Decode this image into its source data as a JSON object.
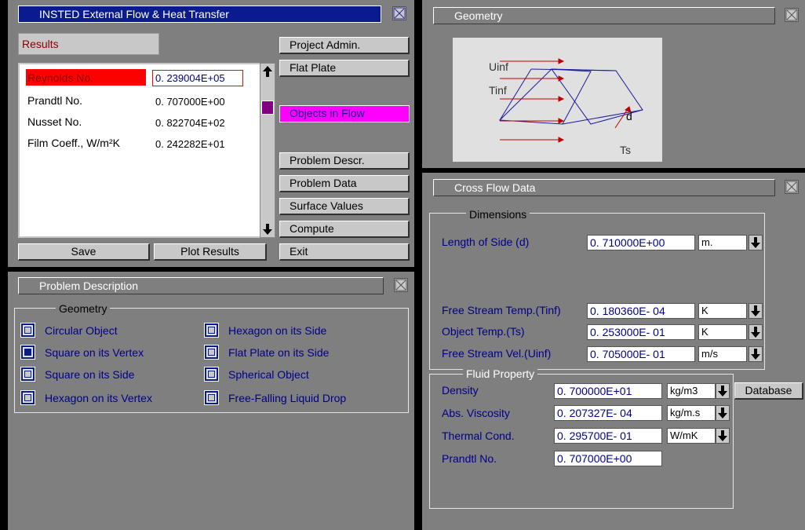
{
  "app": {
    "title": "INSTED External Flow & Heat Transfer"
  },
  "results": {
    "header": "Results",
    "rows": [
      {
        "label": "Reynolds No.",
        "value": "0. 239004E+05"
      },
      {
        "label": "Prandtl No.",
        "value": "0. 707000E+00"
      },
      {
        "label": "Nusset No.",
        "value": "0. 822704E+02"
      },
      {
        "label": "Film Coeff., W/m²K",
        "value": "0. 242282E+01"
      }
    ],
    "save_label": "Save",
    "plot_label": "Plot Results"
  },
  "menu": {
    "project_admin": "Project Admin.",
    "flat_plate": "Flat Plate",
    "objects_in_flow": "Objects in Flow",
    "problem_descr": "Problem Descr.",
    "problem_data": "Problem Data",
    "surface_values": "Surface Values",
    "compute": "Compute",
    "exit": "Exit"
  },
  "geometry_panel": {
    "title": "Geometry",
    "labels": {
      "uinf": "Uinf",
      "tinf": "Tinf",
      "d": "d",
      "ts": "Ts"
    }
  },
  "problem_description": {
    "title": "Problem Description",
    "group": "Geometry",
    "options_left": [
      {
        "label": "Circular Object",
        "checked": false
      },
      {
        "label": "Square on its Vertex",
        "checked": true
      },
      {
        "label": "Square on its Side",
        "checked": false
      },
      {
        "label": "Hexagon on its Vertex",
        "checked": false
      }
    ],
    "options_right": [
      {
        "label": "Hexagon on its Side",
        "checked": false
      },
      {
        "label": "Flat Plate on its Side",
        "checked": false
      },
      {
        "label": "Spherical Object",
        "checked": false
      },
      {
        "label": "Free-Falling Liquid Drop",
        "checked": false
      }
    ]
  },
  "cross_flow": {
    "title": "Cross Flow Data",
    "dimensions_group": "Dimensions",
    "length_label": "Length of Side (d)",
    "length_value": "0. 710000E+00",
    "length_unit": "m.",
    "tinf_label": "Free Stream Temp.(Tinf)",
    "tinf_value": "0. 180360E- 04",
    "tinf_unit": "K",
    "ts_label": "Object Temp.(Ts)",
    "ts_value": "0. 253000E- 01",
    "ts_unit": "K",
    "uinf_label": "Free Stream Vel.(Uinf)",
    "uinf_value": "0. 705000E- 01",
    "uinf_unit": "m/s",
    "fluid_group": "Fluid Property",
    "density_label": "Density",
    "density_value": "0. 700000E+01",
    "density_unit": "kg/m3",
    "database_label": "Database",
    "visc_label": "Abs. Viscosity",
    "visc_value": "0. 207327E- 04",
    "visc_unit": "kg/m.s",
    "cond_label": "Thermal Cond.",
    "cond_value": "0. 295700E- 01",
    "cond_unit": "W/mK",
    "prandtl_label": "Prandtl No.",
    "prandtl_value": "0. 707000E+00"
  },
  "colors": {
    "title_blue": "#0a1a8f",
    "panel_gray": "#7f7f7f",
    "highlight_red": "#ff0000",
    "highlight_magenta": "#ff00ff",
    "value_blue": "#00008b"
  }
}
